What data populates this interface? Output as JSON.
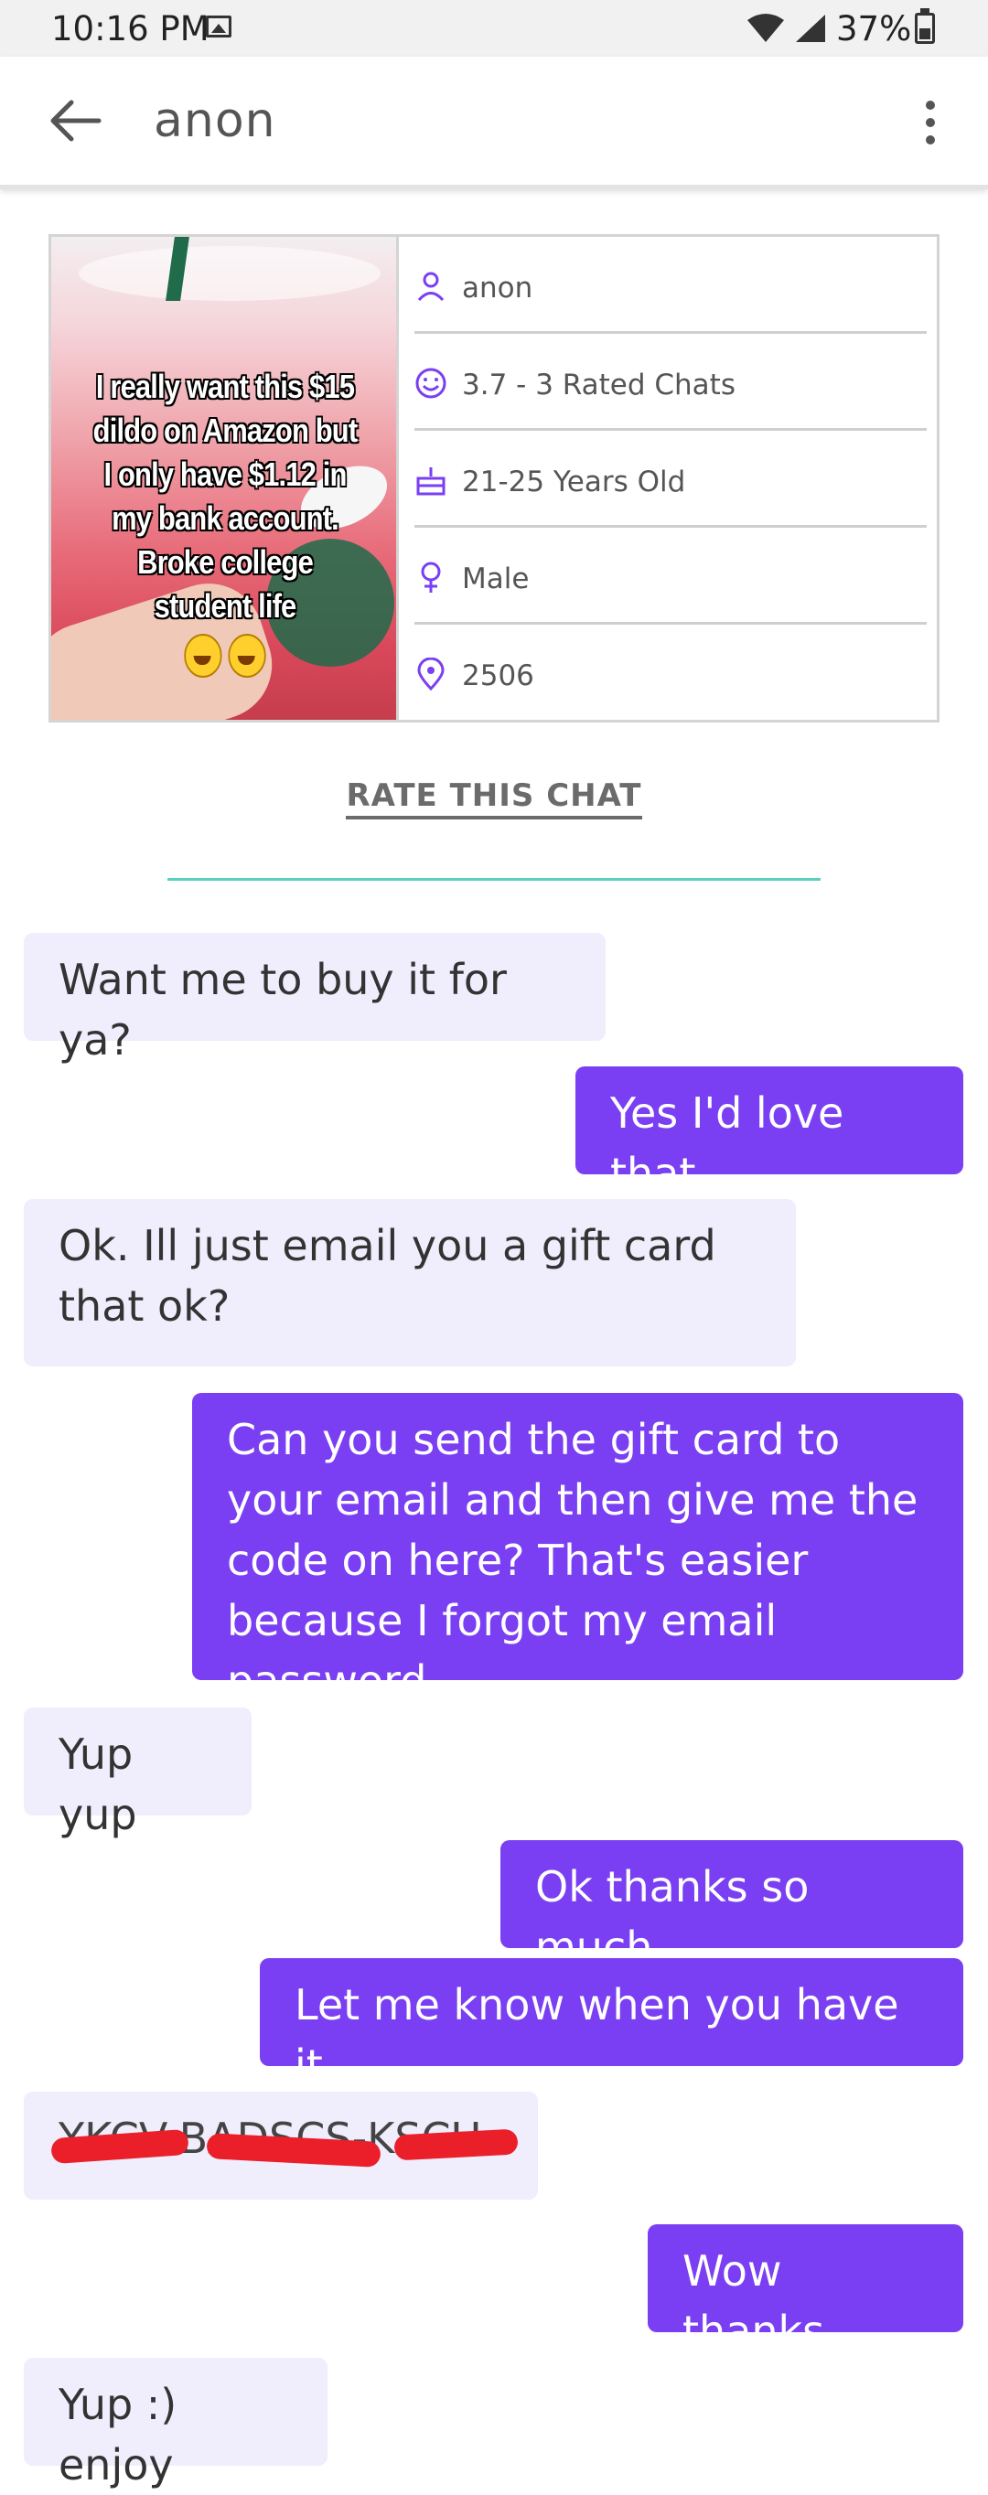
{
  "status_bar": {
    "time": "10:16 PM",
    "battery": "37%"
  },
  "app_bar": {
    "title": "anon"
  },
  "profile": {
    "photo_caption": "I really want this $15 dildo on Amazon but I only have $1.12 in my bank account. Broke college student life",
    "info": [
      {
        "icon": "user-icon",
        "text": "anon"
      },
      {
        "icon": "smiley-icon",
        "text": "3.7 - 3 Rated Chats"
      },
      {
        "icon": "cake-icon",
        "text": "21-25 Years Old"
      },
      {
        "icon": "gender-icon",
        "text": "Male"
      },
      {
        "icon": "location-pin-icon",
        "text": "2506"
      }
    ]
  },
  "rate_chat_label": "RATE THIS CHAT",
  "colors": {
    "accent": "#7a3ff2",
    "incoming_bubble": "#f0edfc",
    "divider_teal": "#57d2bf"
  },
  "messages": [
    {
      "side": "in",
      "text": "Want me to buy it for ya?"
    },
    {
      "side": "out",
      "text": "Yes I'd love that"
    },
    {
      "side": "in",
      "text": "Ok. Ill just email you a gift card that ok?"
    },
    {
      "side": "out",
      "text": "Can you send the gift card to your email and then give me the code on here? That's easier because I forgot my email password"
    },
    {
      "side": "in",
      "text": "Yup yup"
    },
    {
      "side": "out",
      "text": "Ok thanks so much"
    },
    {
      "side": "out",
      "text": "Let me know when you have it"
    },
    {
      "side": "in",
      "text": "YKCV-BADSCS-KSCU",
      "redacted": true
    },
    {
      "side": "out",
      "text": "Wow thanks"
    },
    {
      "side": "in",
      "text": "Yup :) enjoy"
    }
  ]
}
